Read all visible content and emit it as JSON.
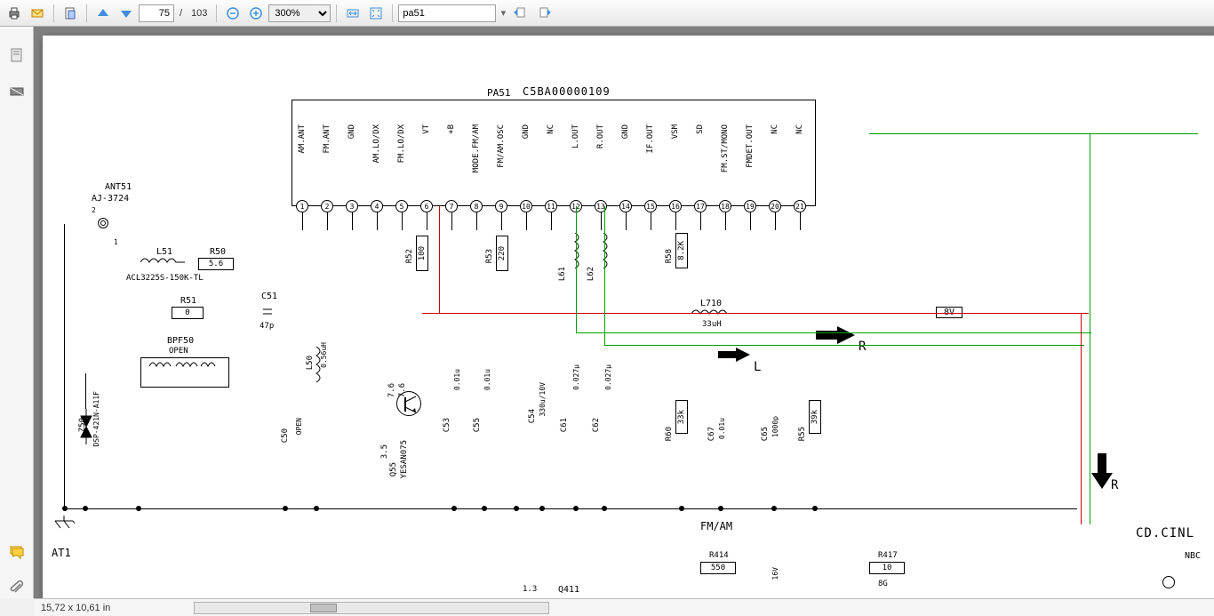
{
  "toolbar": {
    "page_current": "75",
    "page_total": "103",
    "page_sep": "/",
    "zoom": "300%",
    "search_value": "pa51"
  },
  "footer": {
    "dimensions": "15,72 x 10,61 in"
  },
  "schematic": {
    "chip_ref": "PA51",
    "chip_part": "C5BA00000109",
    "pins": [
      {
        "n": "1",
        "label": "AM.ANT"
      },
      {
        "n": "2",
        "label": "FM.ANT"
      },
      {
        "n": "3",
        "label": "GND"
      },
      {
        "n": "4",
        "label": "AM.LO/DX"
      },
      {
        "n": "5",
        "label": "FM.LO/DX"
      },
      {
        "n": "6",
        "label": "VT"
      },
      {
        "n": "7",
        "label": "+B"
      },
      {
        "n": "8",
        "label": "MODE.FM/AM"
      },
      {
        "n": "9",
        "label": "FM/AM.OSC"
      },
      {
        "n": "10",
        "label": "GND"
      },
      {
        "n": "11",
        "label": "NC"
      },
      {
        "n": "12",
        "label": "L.OUT"
      },
      {
        "n": "13",
        "label": "R.OUT"
      },
      {
        "n": "14",
        "label": "GND"
      },
      {
        "n": "15",
        "label": "IF.OUT"
      },
      {
        "n": "16",
        "label": "VSM"
      },
      {
        "n": "17",
        "label": "SD"
      },
      {
        "n": "18",
        "label": "FM.ST/MONO"
      },
      {
        "n": "19",
        "label": "FMDET.OUT"
      },
      {
        "n": "20",
        "label": "NC"
      },
      {
        "n": "21",
        "label": "NC"
      }
    ],
    "ant_ref": "ANT51",
    "ant_part": "AJ-3724",
    "l51": "L51",
    "l51_part": "ACL3225S-150K-TL",
    "r50": "R50",
    "r50_val": "5.6",
    "r51": "R51",
    "r51_val": "0",
    "c51": "C51",
    "c51_val": "47p",
    "bpf50": "BPF50",
    "bpf50_val": "OPEN",
    "z50": "Z50",
    "z50_part": "DSP-421N-A11F",
    "at1": "AT1",
    "l50": "L50",
    "l50_val": "0.56uH",
    "c50": "C50",
    "c50_val": "OPEN",
    "q55": "Q55",
    "q55_part": "YESAN075",
    "q55_e": "3.5",
    "q55_b": "7.6",
    "q55_c": "7.6",
    "r52": "R52",
    "r52_val": "100",
    "r53": "R53",
    "r53_val": "220",
    "c53": "C53",
    "c53_val": "0.01u",
    "c55": "C55",
    "c55_val": "0.01u",
    "l61": "L61",
    "l62": "L62",
    "c54": "C54",
    "c54_val": "330u/10V",
    "c61": "C61",
    "c61_val": "0.027µ",
    "c62": "C62",
    "c62_val": "0.027µ",
    "r58": "R58",
    "r58_val": "8.2K",
    "l710": "L710",
    "l710_val": "33uH",
    "r60": "R60",
    "r60_val": "33k",
    "c67": "C67",
    "c67_val": "0.01u",
    "c65": "C65",
    "c65_val": "1000p",
    "r55": "R55",
    "r55_val": "39k",
    "r414": "R414",
    "r414_val": "550",
    "r417": "R417",
    "r417_val": "10",
    "q411": "Q411",
    "net_8v": "8V",
    "fm_am": "FM/AM",
    "cd_cinl": "CD.CINL",
    "nbc": "NBC",
    "sig_l": "L",
    "sig_r": "R",
    "sig_r2": "R",
    "val_8g": "8G",
    "val_1_3": "1.3",
    "val_16v": "16V"
  }
}
